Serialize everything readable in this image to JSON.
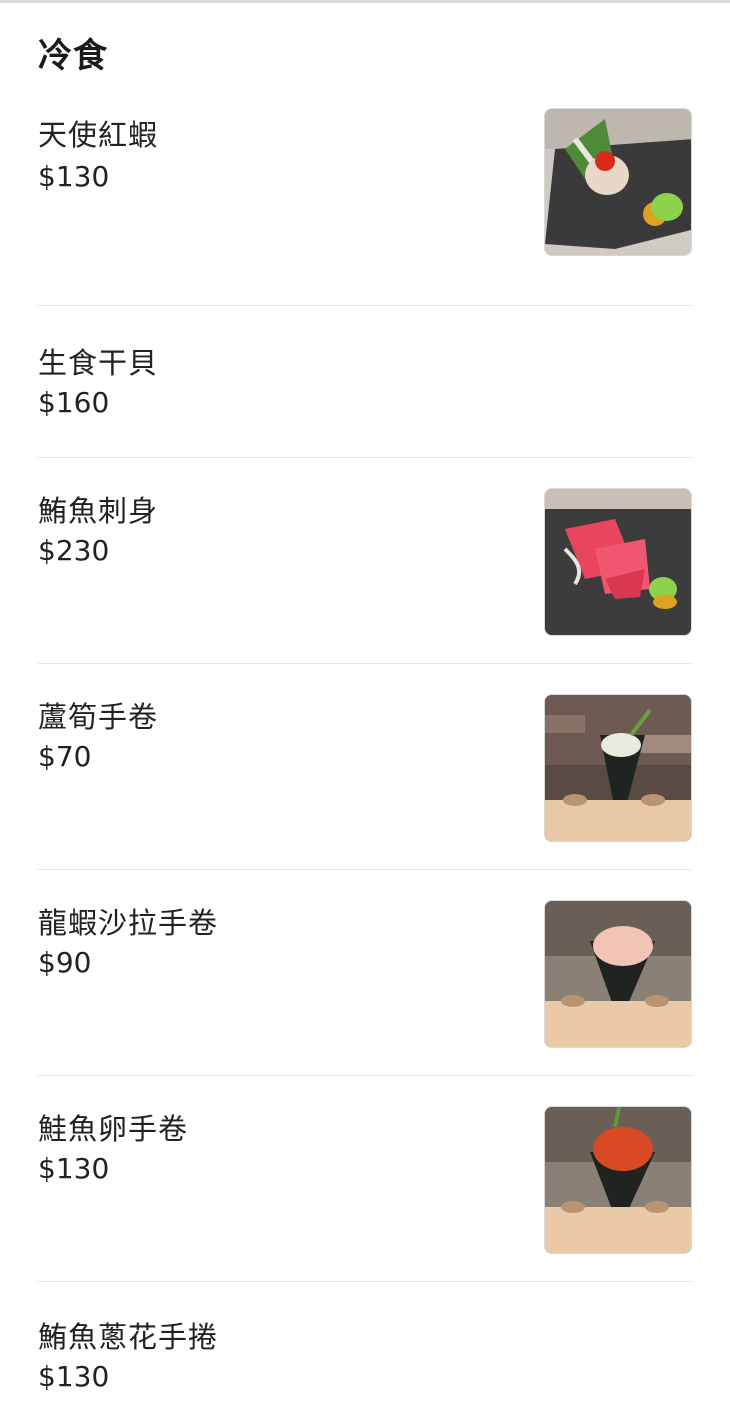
{
  "section": {
    "title": "冷食"
  },
  "items": [
    {
      "name": "天使紅蝦",
      "price": "$130",
      "image_icon": "shrimp-sashimi-photo"
    },
    {
      "name": "生食干貝",
      "price": "$160"
    },
    {
      "name": "鮪魚刺身",
      "price": "$230",
      "image_icon": "tuna-sashimi-photo"
    },
    {
      "name": "蘆筍手卷",
      "price": "$70",
      "image_icon": "asparagus-handroll-photo"
    },
    {
      "name": "龍蝦沙拉手卷",
      "price": "$90",
      "image_icon": "lobster-salad-handroll-photo"
    },
    {
      "name": "鮭魚卵手卷",
      "price": "$130",
      "image_icon": "salmon-roe-handroll-photo"
    },
    {
      "name": "鮪魚蔥花手捲",
      "price": "$130"
    }
  ],
  "colors": {
    "text": "#222222",
    "divider": "#e6e6e6",
    "background": "#ffffff"
  }
}
